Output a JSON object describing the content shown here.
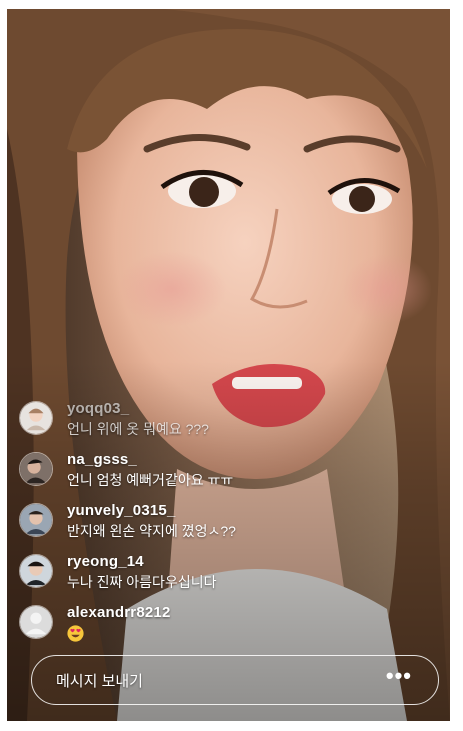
{
  "comments": [
    {
      "username": "yoqq03_",
      "message": "언니 위에 옷 뭐예요 ???",
      "dimmed": true,
      "avatar": "avatar-yoqq03"
    },
    {
      "username": "na_gsss_",
      "message": "언니 엄청 예뻐거같아요 ㅠㅠ",
      "dimmed": false,
      "avatar": "avatar-na-gsss"
    },
    {
      "username": "yunvely_0315_",
      "message": "반지왜 왼손 약지에 꼈엉ㅅ??",
      "dimmed": false,
      "avatar": "avatar-yunvely"
    },
    {
      "username": "ryeong_14",
      "message": "누나 진짜 아름다우십니다",
      "dimmed": false,
      "avatar": "avatar-ryeong"
    },
    {
      "username": "alexandrr8212",
      "message": "",
      "dimmed": false,
      "avatar": "default-avatar-icon",
      "emoji": "heart-eyes-emoji"
    }
  ],
  "composer": {
    "placeholder": "메시지 보내기",
    "more_label": "•••"
  },
  "colors": {
    "text": "#ffffff",
    "emoji": "#f7c63b",
    "heart": "#e0245e"
  }
}
